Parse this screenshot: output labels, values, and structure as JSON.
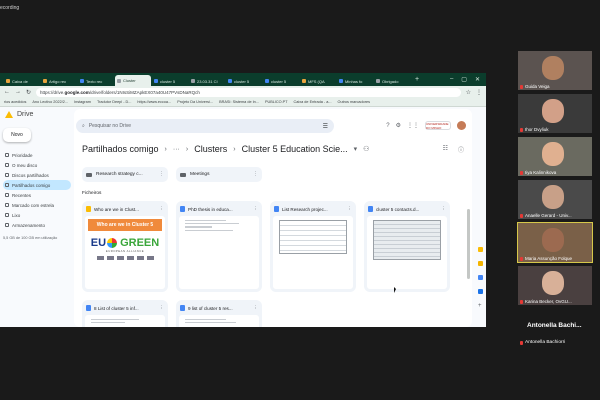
{
  "recording_label": "ecording",
  "browser": {
    "tabs": [
      {
        "label": "Caixa de",
        "fav": "orange",
        "active": false
      },
      {
        "label": "Artigo rec",
        "fav": "orange",
        "active": false
      },
      {
        "label": "Texto rec",
        "fav": "blue",
        "active": false
      },
      {
        "label": "Cluster",
        "fav": "gray",
        "active": true
      },
      {
        "label": "cluster 5",
        "fav": "blue",
        "active": false
      },
      {
        "label": "23.03.31 Cl",
        "fav": "gray",
        "active": false
      },
      {
        "label": "cluster 5",
        "fav": "blue",
        "active": false
      },
      {
        "label": "cluster 5",
        "fav": "blue",
        "active": false
      },
      {
        "label": "MFS (QA",
        "fav": "orange",
        "active": false
      },
      {
        "label": "Minhas fo",
        "fav": "blue",
        "active": false
      },
      {
        "label": "Obrigado",
        "fav": "gray",
        "active": false
      }
    ],
    "url_prefix": "https://drive.",
    "url_domain": "google.com",
    "url_rest": "/drive/folders/1NIsSiMZApkEX07a40U47PVsDNaRQch",
    "bookmarks": [
      "rios acedidos",
      "Ano Lectivo 2022/2...",
      "Instagram",
      "Tradutor Deepl - D...",
      "https://www.eccoa...",
      "Projeto Da Universi...",
      "BRASI: Sistema de In...",
      "PUBLICO.PT",
      "Caixa de Entrada - a...",
      "Outros marcadores"
    ]
  },
  "drive": {
    "app_name": "Drive",
    "new_label": "Novo",
    "nav": [
      {
        "label": "Prioridade",
        "active": false
      },
      {
        "label": "O meu disco",
        "active": false
      },
      {
        "label": "Discos partilhados",
        "active": false
      },
      {
        "label": "Partilhados comigo",
        "active": true
      },
      {
        "label": "Recentes",
        "active": false
      },
      {
        "label": "Marcado com estrela",
        "active": false
      },
      {
        "label": "Lixo",
        "active": false
      },
      {
        "label": "Armazenamento",
        "active": false
      }
    ],
    "storage": "5,5 GB de 100 GB em utilização",
    "search_placeholder": "Pesquisar no Drive",
    "org_label": "UNIVERSIDADE DO MINHO",
    "breadcrumb": {
      "root": "Partilhados comigo",
      "more": "···",
      "parent": "Clusters",
      "current": "Cluster 5 Education Scie..."
    },
    "folders": [
      "Research strategy c...",
      "Meetings"
    ],
    "files_heading": "Ficheiros",
    "files": [
      {
        "name": "Who are we in Clust...",
        "type": "slides"
      },
      {
        "name": "PhD thesis in educa...",
        "type": "docs"
      },
      {
        "name": "List Research projec...",
        "type": "docs"
      },
      {
        "name": "cluster 5 contacts.d...",
        "type": "docs"
      },
      {
        "name": "8 List of cluster 5 inf...",
        "type": "docs"
      },
      {
        "name": "9 list of cluster 5 res...",
        "type": "docs"
      }
    ],
    "slide_preview": {
      "banner": "Who are we in Cluster 5",
      "brand_left": "EU",
      "brand_right": "GREEN",
      "tagline": "EUROPEAN ALLIANCE"
    }
  },
  "participants": [
    {
      "name": "Guida Veiga",
      "face": "#b08060",
      "bg": "#5b5350"
    },
    {
      "name": "Ihor Dvyliuk",
      "face": "#d2a088",
      "bg": "#3a3a3a"
    },
    {
      "name": "Iiya Kalinnikova",
      "face": "#e0b090",
      "bg": "#6a6a60"
    },
    {
      "name": "Anaelle Gerard - Univ...",
      "face": "#c8a088",
      "bg": "#4a4a4a"
    },
    {
      "name": "Maria Assunção Folque",
      "face": "#9c6a50",
      "bg": "#7a6048"
    },
    {
      "name": "Karina Becker, OvGU...",
      "face": "#d8b098",
      "bg": "#4a4040"
    }
  ],
  "speaker_big": "Antonella Bachi...",
  "speaker_small": "Antonella Bachiorri"
}
